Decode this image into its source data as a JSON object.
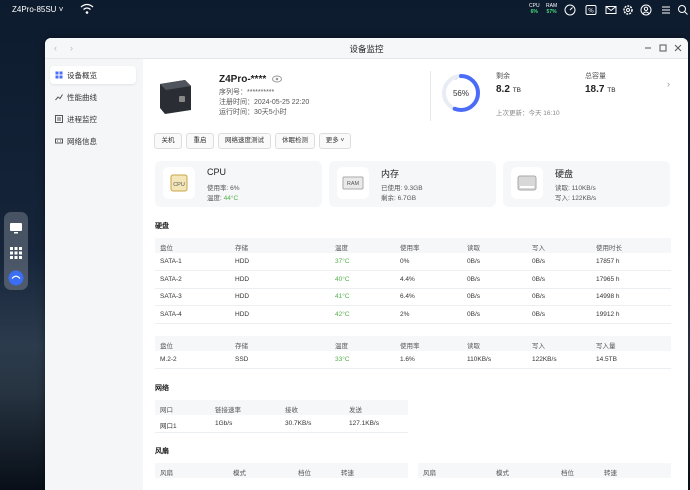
{
  "topbar": {
    "device_name": "Z4Pro-85SU",
    "cpu_label": "CPU",
    "cpu_value": "6%",
    "ram_label": "RAM",
    "ram_value": "57%"
  },
  "window": {
    "title": "设备监控"
  },
  "sidebar": {
    "items": [
      {
        "label": "设备概览",
        "icon": "overview-icon"
      },
      {
        "label": "性能曲线",
        "icon": "chart-icon"
      },
      {
        "label": "进程监控",
        "icon": "process-icon"
      },
      {
        "label": "网络信息",
        "icon": "network-icon"
      }
    ]
  },
  "device": {
    "name": "Z4Pro-****",
    "serial": "序列号：**********",
    "registered": "注册时间：2024-05-25 22:20",
    "uptime": "运行时间：30天5小时"
  },
  "storage": {
    "percent": 56,
    "percent_label": "56%",
    "remaining_label": "剩余",
    "remaining_value": "8.2",
    "remaining_unit": "TB",
    "total_label": "总容量",
    "total_value": "18.7",
    "total_unit": "TB",
    "updated": "上次更新：今天 16:10"
  },
  "actions": {
    "shutdown": "关机",
    "restart": "重启",
    "speedtest": "网络速度测试",
    "sleep_check": "休眠检测",
    "more": "更多"
  },
  "cards": {
    "cpu": {
      "title": "CPU",
      "icon_text": "CPU",
      "usage": "使用率: 6%",
      "temp_label": "温度: ",
      "temp_value": "44°C"
    },
    "mem": {
      "title": "内存",
      "icon_text": "RAM",
      "used": "已使用: 9.3GB",
      "free": "剩余: 6.7GB"
    },
    "disk": {
      "title": "硬盘",
      "read": "读取: 110KB/s",
      "write": "写入: 122KB/s"
    }
  },
  "disks": {
    "section_title": "硬盘",
    "headers": [
      "盘位",
      "存储",
      "温度",
      "使用率",
      "读取",
      "写入",
      "使用时长"
    ],
    "rows": [
      [
        "SATA-1",
        "HDD",
        "37°C",
        "0%",
        "0B/s",
        "0B/s",
        "17857 h"
      ],
      [
        "SATA-2",
        "HDD",
        "40°C",
        "4.4%",
        "0B/s",
        "0B/s",
        "17965 h"
      ],
      [
        "SATA-3",
        "HDD",
        "41°C",
        "6.4%",
        "0B/s",
        "0B/s",
        "14998 h"
      ],
      [
        "SATA-4",
        "HDD",
        "42°C",
        "2%",
        "0B/s",
        "0B/s",
        "19912 h"
      ]
    ]
  },
  "m2": {
    "headers": [
      "盘位",
      "存储",
      "温度",
      "使用率",
      "读取",
      "写入",
      "写入量"
    ],
    "rows": [
      [
        "M.2-2",
        "SSD",
        "33°C",
        "1.6%",
        "110KB/s",
        "122KB/s",
        "14.5TB"
      ]
    ]
  },
  "network": {
    "section_title": "网络",
    "headers": [
      "网口",
      "链接速率",
      "接收",
      "发送"
    ],
    "rows": [
      [
        "网口1",
        "1Gb/s",
        "30.7KB/s",
        "127.1KB/s"
      ]
    ]
  },
  "fans": {
    "section_title": "风扇",
    "headers": [
      "风扇",
      "模式",
      "档位",
      "转速"
    ]
  },
  "colors": {
    "accent": "#4a6cf7",
    "temp_green": "#52b04a"
  }
}
